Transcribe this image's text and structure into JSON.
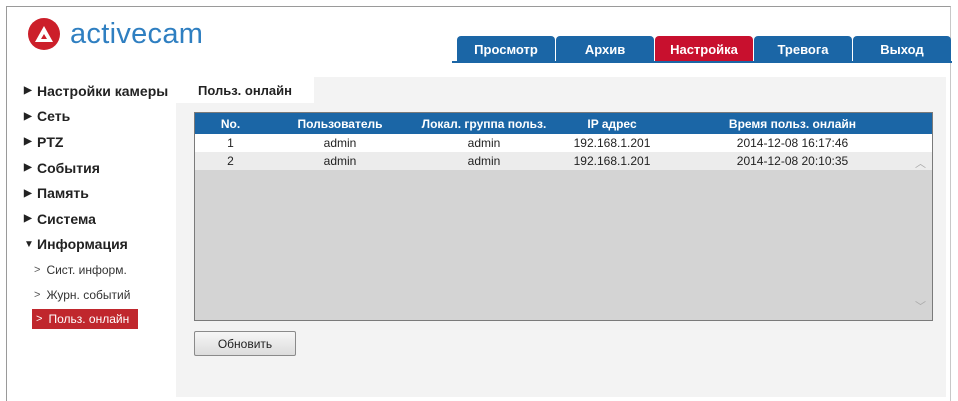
{
  "brand": {
    "name": "activecam",
    "logo_color": "#cc1f2a",
    "text_color": "#2f7fc1"
  },
  "nav": {
    "tabs": [
      {
        "label": "Просмотр",
        "active": false
      },
      {
        "label": "Архив",
        "active": false
      },
      {
        "label": "Настройка",
        "active": true
      },
      {
        "label": "Тревога",
        "active": false
      },
      {
        "label": "Выход",
        "active": false
      }
    ],
    "accent": "#1b66a6",
    "active_color": "#c8102e"
  },
  "sidebar": {
    "items": [
      {
        "label": "Настройки камеры",
        "icon": "triangle-right-icon"
      },
      {
        "label": "Сеть",
        "icon": "triangle-right-icon"
      },
      {
        "label": "PTZ",
        "icon": "triangle-right-icon"
      },
      {
        "label": "События",
        "icon": "triangle-right-icon"
      },
      {
        "label": "Память",
        "icon": "triangle-right-icon"
      },
      {
        "label": "Система",
        "icon": "triangle-right-icon"
      },
      {
        "label": "Информация",
        "icon": "triangle-down-icon"
      }
    ],
    "subitems": [
      {
        "label": "Сист. информ.",
        "active": false
      },
      {
        "label": "Журн. событий",
        "active": false
      },
      {
        "label": "Польз. онлайн",
        "active": true
      }
    ]
  },
  "content": {
    "tab": "Польз. онлайн",
    "table": {
      "headers": [
        "No.",
        "Пользователь",
        "Локал. группа польз.",
        "IP адрес",
        "Время польз. онлайн"
      ],
      "rows": [
        [
          "1",
          "admin",
          "admin",
          "192.168.1.201",
          "2014-12-08 16:17:46"
        ],
        [
          "2",
          "admin",
          "admin",
          "192.168.1.201",
          "2014-12-08 20:10:35"
        ]
      ]
    },
    "refresh_label": "Обновить"
  }
}
